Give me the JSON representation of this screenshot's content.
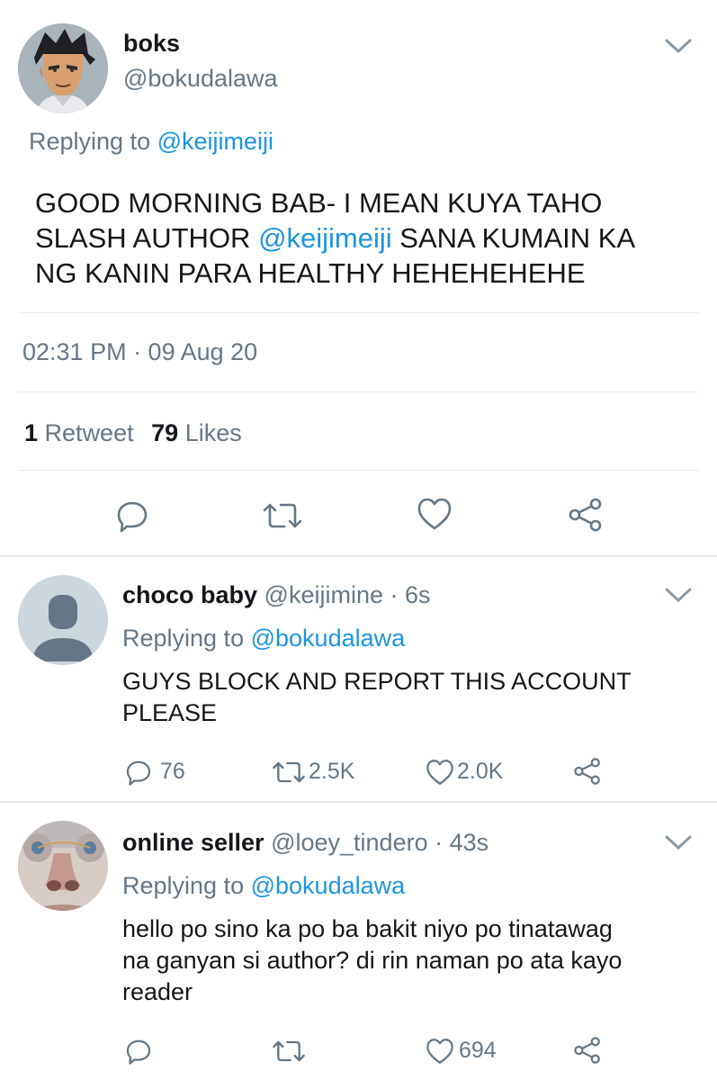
{
  "main_tweet": {
    "display_name": "boks",
    "handle": "@bokudalawa",
    "replying_label": "Replying to",
    "replying_to": "@keijimeiji",
    "text_line1": "GOOD MORNING BAB- I MEAN KUYA TAHO",
    "text_line2_a": "SLASH AUTHOR ",
    "text_line2_mention": "@keijimeiji",
    "text_line2_b": " SANA KUMAIN KA",
    "text_line3": "NG KANIN PARA HEALTHY HEHEHEHEHE",
    "timestamp": "02:31 PM · 09 Aug 20",
    "retweet_count": "1",
    "retweet_label": "Retweet",
    "like_count": "79",
    "like_label": "Likes"
  },
  "replies": [
    {
      "display_name": "choco baby",
      "handle": "@keijimine · 6s",
      "replying_label": "Replying to",
      "replying_to": "@bokudalawa",
      "text_line1": "GUYS BLOCK AND REPORT THIS ACCOUNT",
      "text_line2": "PLEASE",
      "reply_count": "76",
      "retweet_count": "2.5K",
      "like_count": "2.0K"
    },
    {
      "display_name": "online seller",
      "handle": "@loey_tindero · 43s",
      "replying_label": "Replying to",
      "replying_to": "@bokudalawa",
      "text_line1": "hello po sino ka po ba bakit niyo po tinatawag",
      "text_line2": "na ganyan si author? di rin naman po ata kayo",
      "text_line3": "reader",
      "like_count": "694"
    }
  ],
  "icons": [
    "chevron-down-icon",
    "reply-icon",
    "retweet-icon",
    "like-icon",
    "share-icon"
  ],
  "colors": {
    "accent": "#1b95e0",
    "secondary_text": "#657786",
    "divider": "#e6ecf0"
  }
}
